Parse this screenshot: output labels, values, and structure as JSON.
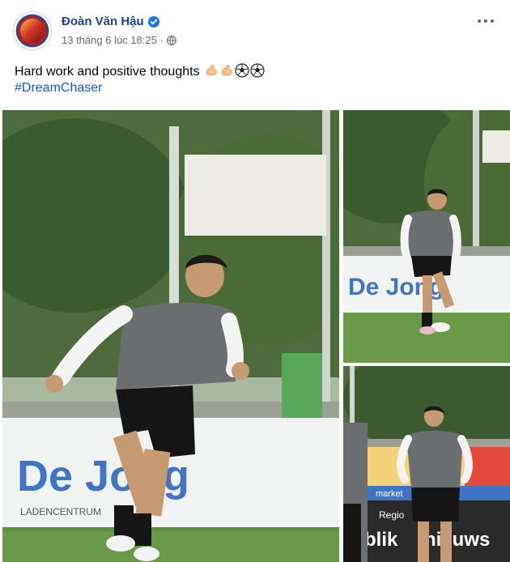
{
  "post": {
    "author_name": "Đoàn Văn Hậu",
    "timestamp": "13 tháng 6 lúc 18:25",
    "separator": "·",
    "text": "Hard work and positive thoughts",
    "emojis": [
      "flexed-biceps",
      "flexed-biceps",
      "soccer-ball",
      "soccer-ball"
    ],
    "hashtag": "#DreamChaser"
  },
  "photos": {
    "main": {
      "banner_text": "De Jong",
      "sub_text": "LADENCENTRUM"
    },
    "top_right": {
      "banner_text": "De Jong"
    },
    "bottom_right": {
      "banner_text": "blik",
      "banner_text_2": "nieuws",
      "label_text": "Regio",
      "market_text": "market"
    }
  },
  "colors": {
    "author": "#1f3f8f",
    "link": "#1c57b5",
    "meta": "#65676b",
    "verified": "#1877f2",
    "grass": "#5f8f3e",
    "trees": "#3b5a2e"
  }
}
